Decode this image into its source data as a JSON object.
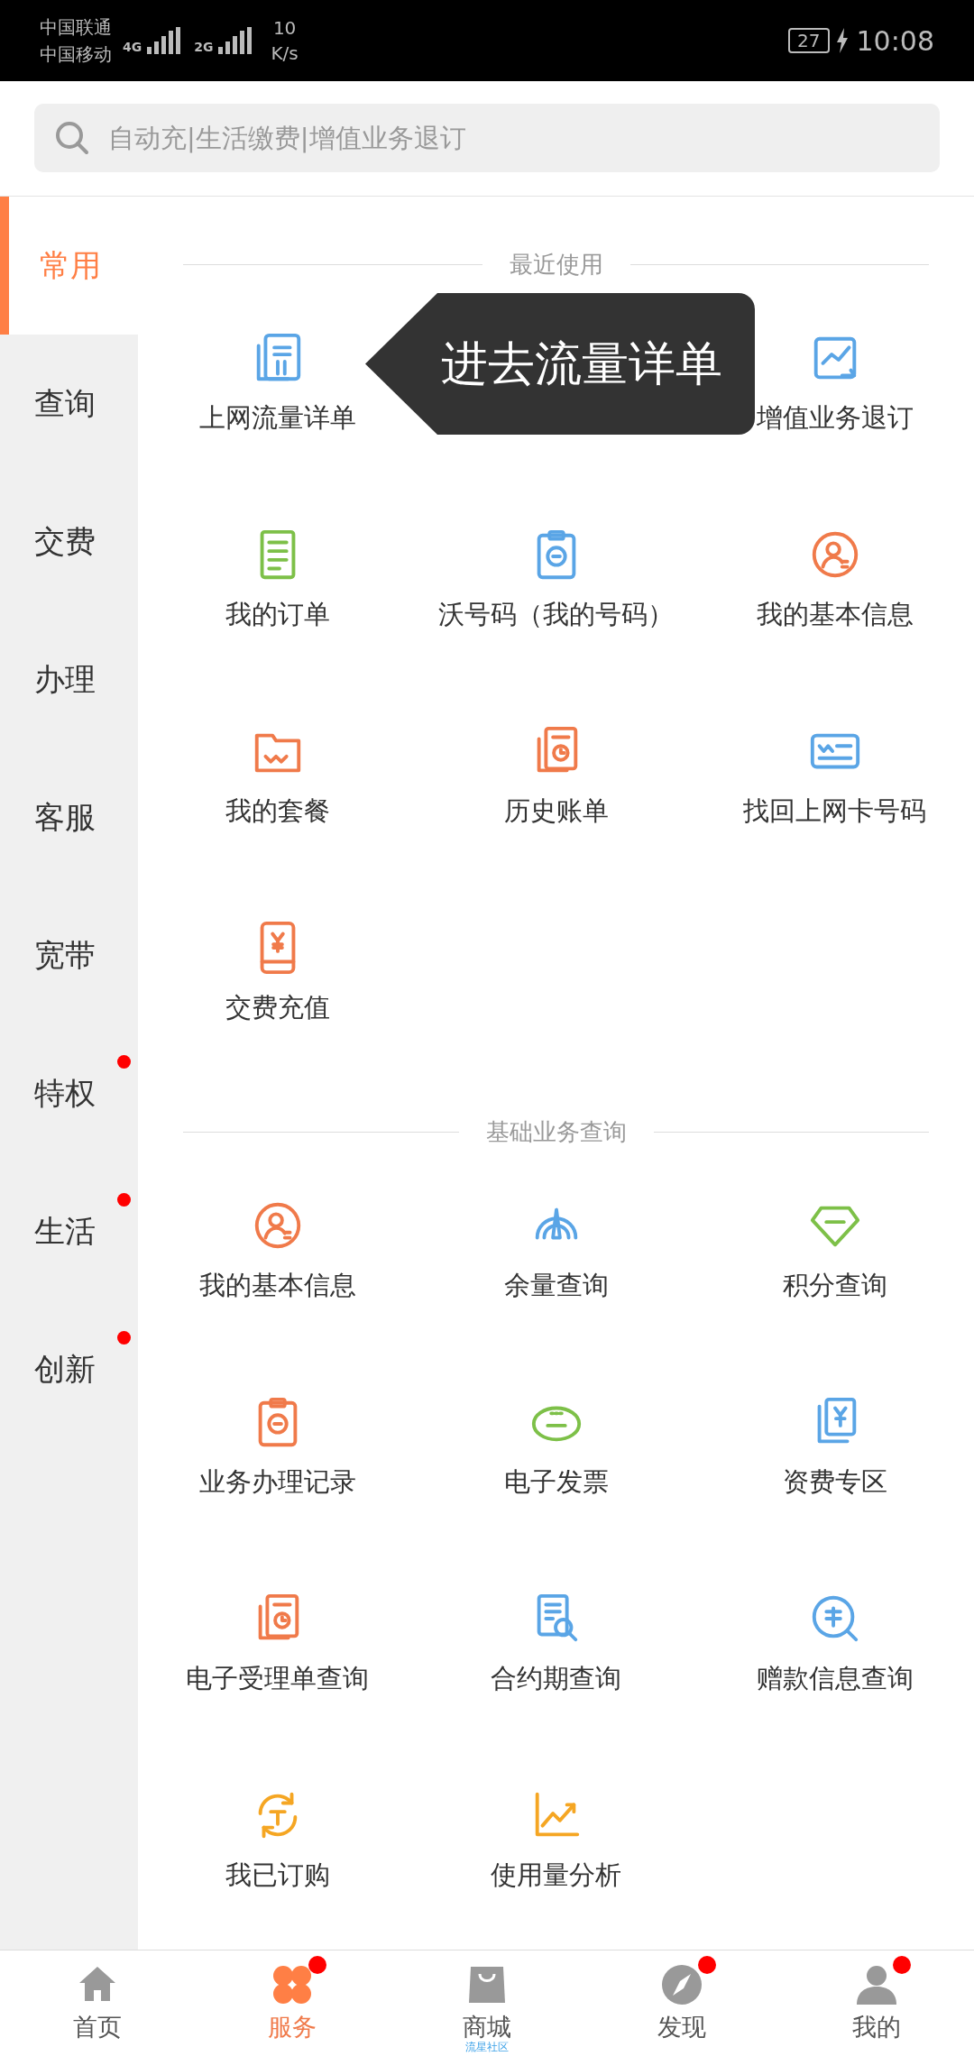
{
  "status_bar": {
    "carriers": [
      "中国联通",
      "中国移动"
    ],
    "network_1": "4G",
    "network_2": "2G",
    "speed_value": "10",
    "speed_unit": "K/s",
    "battery": "27",
    "time": "10:08"
  },
  "search": {
    "placeholder": "自动充|生活缴费|增值业务退订"
  },
  "sidebar": {
    "items": [
      {
        "label": "常用",
        "selected": true,
        "badge": false
      },
      {
        "label": "查询",
        "selected": false,
        "badge": false
      },
      {
        "label": "交费",
        "selected": false,
        "badge": false
      },
      {
        "label": "办理",
        "selected": false,
        "badge": false
      },
      {
        "label": "客服",
        "selected": false,
        "badge": false
      },
      {
        "label": "宽带",
        "selected": false,
        "badge": false
      },
      {
        "label": "特权",
        "selected": false,
        "badge": true
      },
      {
        "label": "生活",
        "selected": false,
        "badge": true
      },
      {
        "label": "创新",
        "selected": false,
        "badge": true
      }
    ]
  },
  "sections": [
    {
      "title": "最近使用",
      "items": [
        {
          "kind": "link",
          "label": "上网流量详单",
          "color": "#5aa5e6"
        },
        {
          "kind": "tooltip",
          "text": "进去流量详单"
        },
        {
          "kind": "link",
          "label": "增值业务退订",
          "color": "#5aa5e6"
        },
        {
          "kind": "link",
          "label": "我的订单",
          "color": "#7dc048"
        },
        {
          "kind": "link",
          "label": "沃号码（我的号码）",
          "color": "#5aa5e6"
        },
        {
          "kind": "link",
          "label": "我的基本信息",
          "color": "#f07a4a"
        },
        {
          "kind": "link",
          "label": "我的套餐",
          "color": "#f07a4a"
        },
        {
          "kind": "link",
          "label": "历史账单",
          "color": "#f07a4a"
        },
        {
          "kind": "link",
          "label": "找回上网卡号码",
          "color": "#5aa5e6"
        },
        {
          "kind": "link",
          "label": "交费充值",
          "color": "#f07a4a"
        }
      ]
    },
    {
      "title": "基础业务查询",
      "items": [
        {
          "kind": "link",
          "label": "我的基本信息",
          "color": "#f07a4a"
        },
        {
          "kind": "link",
          "label": "余量查询",
          "color": "#5aa5e6"
        },
        {
          "kind": "link",
          "label": "积分查询",
          "color": "#7dc048"
        },
        {
          "kind": "link",
          "label": "业务办理记录",
          "color": "#f07a4a"
        },
        {
          "kind": "link",
          "label": "电子发票",
          "color": "#7dc048"
        },
        {
          "kind": "link",
          "label": "资费专区",
          "color": "#5aa5e6"
        },
        {
          "kind": "link",
          "label": "电子受理单查询",
          "color": "#f07a4a"
        },
        {
          "kind": "link",
          "label": "合约期查询",
          "color": "#5aa5e6"
        },
        {
          "kind": "link",
          "label": "赠款信息查询",
          "color": "#5aa5e6"
        },
        {
          "kind": "link",
          "label": "我已订购",
          "color": "#f5a623"
        },
        {
          "kind": "link",
          "label": "使用量分析",
          "color": "#f5a623"
        }
      ]
    }
  ],
  "tab_bar": [
    {
      "label": "首页",
      "selected": false,
      "badge": false
    },
    {
      "label": "服务",
      "selected": true,
      "badge": true
    },
    {
      "label": "商城",
      "selected": false,
      "badge": false,
      "caption": "流星社区"
    },
    {
      "label": "发现",
      "selected": false,
      "badge": true
    },
    {
      "label": "我的",
      "selected": false,
      "badge": true
    }
  ]
}
